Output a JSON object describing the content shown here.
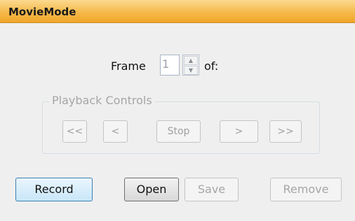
{
  "window": {
    "title": "MovieMode"
  },
  "frame": {
    "label": "Frame",
    "value": "1",
    "of_label": "of:"
  },
  "playback": {
    "group_label": "Playback Controls",
    "buttons": [
      "<<",
      "<",
      "Stop",
      ">",
      ">>"
    ]
  },
  "actions": {
    "record": "Record",
    "open": "Open",
    "save": "Save",
    "remove": "Remove"
  },
  "spinner": {
    "up_icon": "▲",
    "down_icon": "▼"
  },
  "colors": {
    "title_bar": "#f5b94a",
    "disabled_text": "#a6a6a6",
    "record_border": "#3c7fb1"
  }
}
